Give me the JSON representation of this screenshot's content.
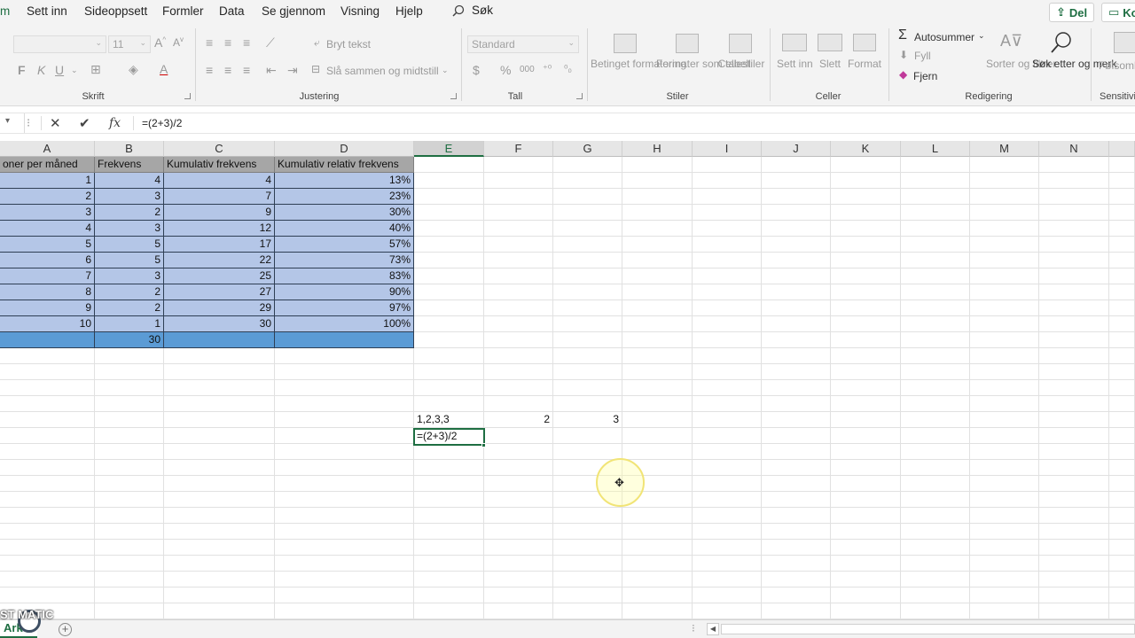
{
  "menu": {
    "items": [
      "m",
      "Sett inn",
      "Sideoppsett",
      "Formler",
      "Data",
      "Se gjennom",
      "Visning",
      "Hjelp"
    ],
    "search": "Søk",
    "share": "Del",
    "comments": "Ko"
  },
  "ribbon": {
    "font": {
      "name": "",
      "size": "11",
      "bold": "F",
      "italic": "K",
      "underline": "U",
      "label": "Skrift"
    },
    "alignment": {
      "wrap": "Bryt tekst",
      "merge": "Slå sammen og midtstill",
      "label": "Justering"
    },
    "number": {
      "format": "Standard",
      "currency": "$",
      "percent": "%",
      "thousands": "000",
      "label": "Tall"
    },
    "styles": {
      "conditional": "Betinget formatering",
      "table": "Formater som tabell",
      "cell_styles": "Cellestiler",
      "label": "Stiler"
    },
    "cells": {
      "insert": "Sett inn",
      "delete": "Slett",
      "format": "Format",
      "label": "Celler"
    },
    "editing": {
      "autosum": "Autosummer",
      "fill": "Fyll",
      "clear": "Fjern",
      "sort": "Sorter og filtrer",
      "find": "Søk etter og merk",
      "label": "Redigering"
    },
    "sensitivity": {
      "button": "Følsomh",
      "label": "Sensitivi"
    }
  },
  "formula_bar": {
    "cancel": "✕",
    "confirm": "✔",
    "fx": "fx",
    "value": "=(2+3)/2"
  },
  "columns": [
    "A",
    "B",
    "C",
    "D",
    "E",
    "F",
    "G",
    "H",
    "I",
    "J",
    "K",
    "L",
    "M",
    "N"
  ],
  "selected_column": "E",
  "table": {
    "headers": [
      "oner per måned",
      "Frekvens",
      "Kumulativ frekvens",
      "Kumulativ relativ frekvens"
    ],
    "rows": [
      [
        "1",
        "4",
        "4",
        "13%"
      ],
      [
        "2",
        "3",
        "7",
        "23%"
      ],
      [
        "3",
        "2",
        "9",
        "30%"
      ],
      [
        "4",
        "3",
        "12",
        "40%"
      ],
      [
        "5",
        "5",
        "17",
        "57%"
      ],
      [
        "6",
        "5",
        "22",
        "73%"
      ],
      [
        "7",
        "3",
        "25",
        "83%"
      ],
      [
        "8",
        "2",
        "27",
        "90%"
      ],
      [
        "9",
        "2",
        "29",
        "97%"
      ],
      [
        "10",
        "1",
        "30",
        "100%"
      ]
    ],
    "total": [
      "",
      "30",
      "",
      ""
    ]
  },
  "extra_cells": {
    "e_list": "1,2,3,3",
    "f_value": "2",
    "g_value": "3",
    "active_edit": "=(2+3)/2"
  },
  "bottom": {
    "sheet_tab": "Ark",
    "add_sheet": "+",
    "watermark": "ST   MATIC"
  },
  "colors": {
    "accent": "#1e6e42",
    "table_row": "#b4c6e7",
    "table_header": "#a6a6a6",
    "table_total": "#5b9bd5"
  }
}
